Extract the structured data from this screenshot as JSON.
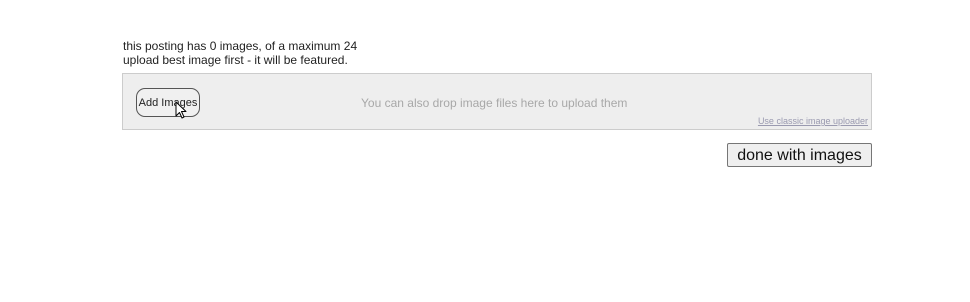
{
  "status": {
    "image_count_text": "this posting has 0 images, of a maximum 24",
    "upload_hint_text": "upload best image first - it will be featured."
  },
  "uploader": {
    "add_images_label": "Add Images",
    "drop_hint": "You can also drop image files here to upload them",
    "classic_link": "Use classic image uploader"
  },
  "actions": {
    "done_label": "done with images"
  },
  "icons": {
    "cursor": "mouse-pointer-icon"
  },
  "colors": {
    "dropzone_bg": "#eeeeee",
    "hint_text": "#a8a8a8",
    "link_text": "#9a9ab0"
  }
}
